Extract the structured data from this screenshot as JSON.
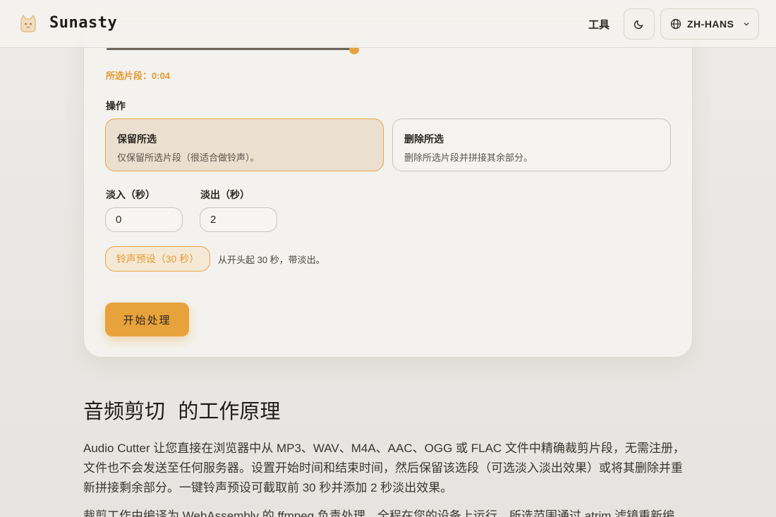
{
  "header": {
    "brand": "Sunasty",
    "nav_tools": "工具",
    "language": "ZH-HANS",
    "logo_icon": "cat-logo-icon",
    "theme_icon": "moon-icon",
    "language_icon": "globe-icon",
    "dropdown_icon": "chevron-down-icon"
  },
  "editor": {
    "selected_segment_label": "所选片段：",
    "selected_segment_value": "0:04",
    "operations_label": "操作",
    "operations": [
      {
        "title": "保留所选",
        "description": "仅保留所选片段（很适合做铃声）。",
        "selected": true
      },
      {
        "title": "删除所选",
        "description": "删除所选片段并拼接其余部分。",
        "selected": false
      }
    ],
    "fade_in_label": "淡入（秒）",
    "fade_in_value": "0",
    "fade_out_label": "淡出（秒）",
    "fade_out_value": "2",
    "preset_button": "铃声预设（30 秒）",
    "preset_note": "从开头起 30 秒，带淡出。",
    "start_button": "开始处理"
  },
  "article": {
    "title": "音频剪切  的工作原理",
    "paragraph1": "Audio Cutter 让您直接在浏览器中从 MP3、WAV、M4A、AAC、OGG 或 FLAC 文件中精确裁剪片段，无需注册，文件也不会发送至任何服务器。设置开始时间和结束时间，然后保留该选段（可选淡入淡出效果）或将其删除并重新拼接剩余部分。一键铃声预设可截取前 30 秒并添加 2 秒淡出效果。",
    "paragraph2": "裁剪工作由编译为 WebAssembly 的 ffmpeg 负责处理，全程在您的设备上运行。所选范围通过 atrim 滤镜重新编"
  },
  "colors": {
    "accent": "#e8a23c",
    "accent_text": "#e39a30",
    "background": "#e9e7e3",
    "card": "#f3f2ee"
  }
}
